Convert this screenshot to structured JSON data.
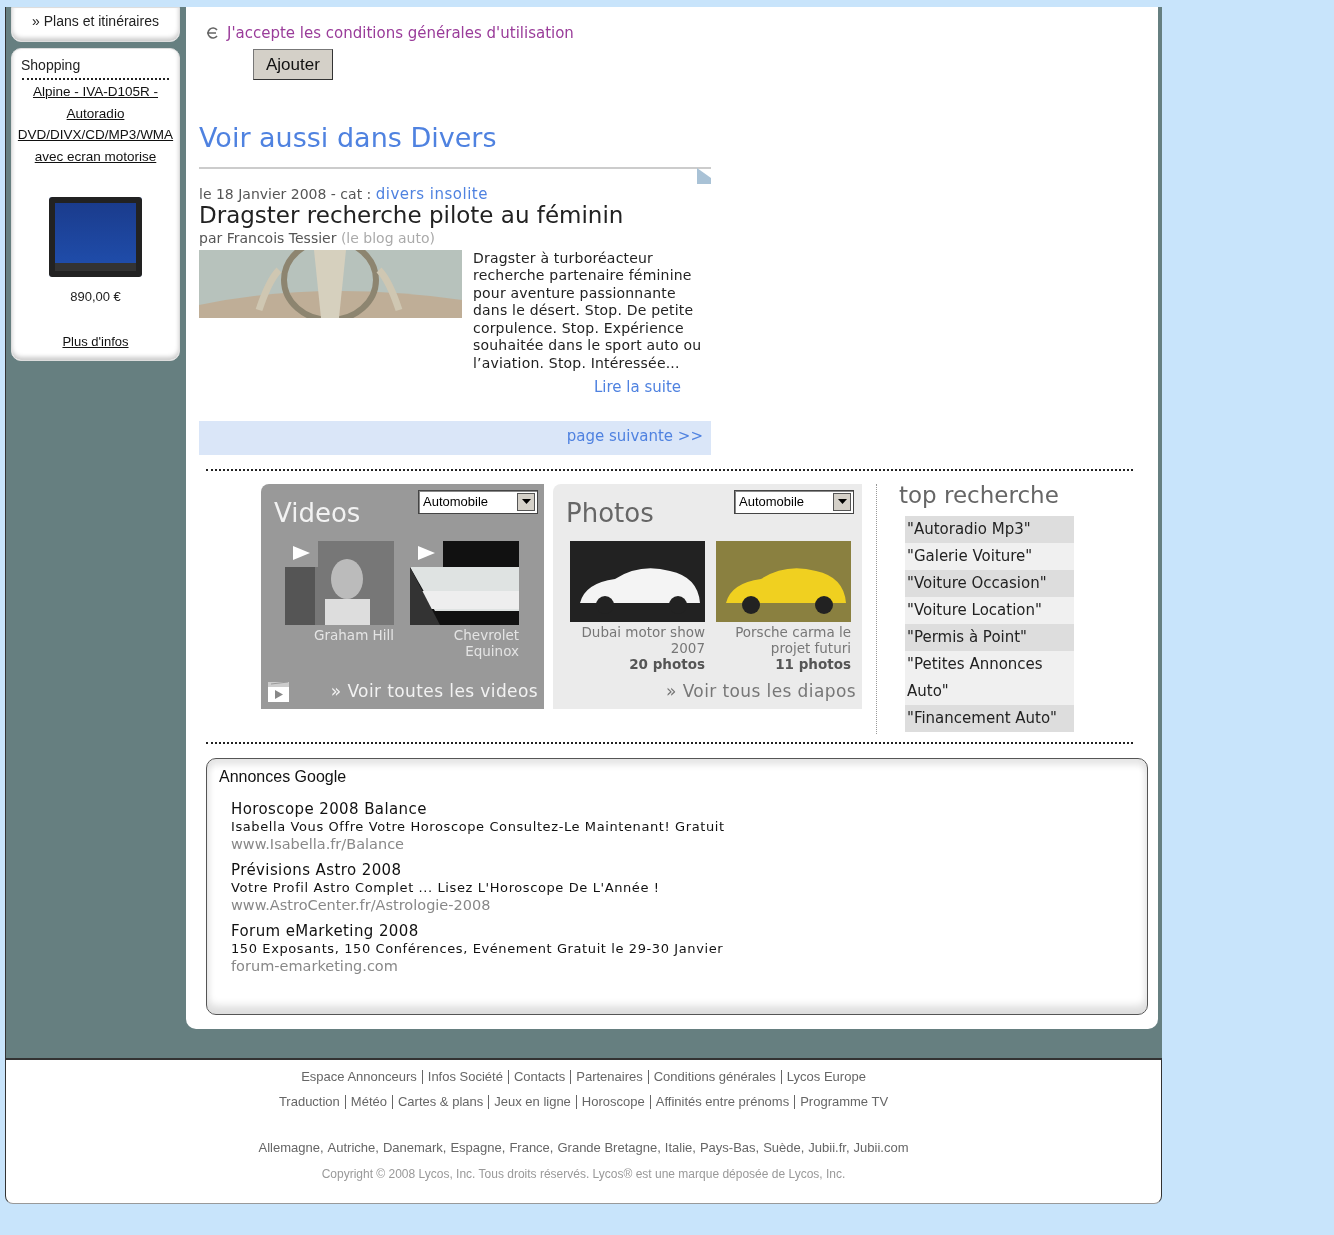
{
  "sidebar": {
    "nav_link": "» Plans et itinéraires",
    "shopping": {
      "title": "Shopping",
      "product_link": "Alpine - IVA-D105R - Autoradio DVD/DIVX/CD/MP3/WMA avec ecran motorise",
      "price": "890,00 €",
      "more_link": "Plus d'infos"
    }
  },
  "terms": {
    "prefix": "J'accepte les",
    "link": "conditions générales d'utilisation"
  },
  "submit_button": "Ajouter",
  "related": {
    "title": "Voir aussi dans Divers",
    "article": {
      "date": "le 18 Janvier 2008 - cat :",
      "category": "divers insolite",
      "title": "Dragster recherche pilote au féminin",
      "author": "par Francois Tessier",
      "source": "(le blog auto)",
      "summary": "Dragster à turboréacteur recherche partenaire féminine pour aventure passionnante dans le désert. Stop. De petite corpulence. Stop. Expérience souhaitée dans le sport auto ou l’aviation. Stop. Intéressée...",
      "read_more": "Lire la suite"
    },
    "next_page": "page suivante >>"
  },
  "videos": {
    "title": "Videos",
    "dropdown": "Automobile",
    "items": [
      {
        "caption": "Graham Hill"
      },
      {
        "caption": "Chevrolet Equinox"
      }
    ],
    "link": "» Voir toutes les videos"
  },
  "photos": {
    "title": "Photos",
    "dropdown": "Automobile",
    "items": [
      {
        "caption": "Dubai motor show 2007",
        "count": "20 photos",
        "kind": "white-car"
      },
      {
        "caption": "Porsche carma le projet futuri",
        "count": "11 photos",
        "kind": "yellow-car"
      }
    ],
    "link": "» Voir tous les diapos"
  },
  "top_search": {
    "title": "top recherche",
    "items": [
      "\"Autoradio Mp3\"",
      "\"Galerie Voiture\"",
      "\"Voiture Occasion\"",
      "\"Voiture Location\"",
      "\"Permis à Point\"",
      "\"Petites Annonces Auto\"",
      "\"Financement Auto\""
    ]
  },
  "ads": {
    "title": "Annonces Google",
    "items": [
      {
        "title": "Horoscope 2008 Balance",
        "text": "Isabella Vous Offre Votre Horoscope Consultez-Le Maintenant! Gratuit",
        "url": "www.Isabella.fr/Balance"
      },
      {
        "title": "Prévisions Astro 2008",
        "text": "Votre Profil Astro Complet ... Lisez L'Horoscope De L'Année !",
        "url": "www.AstroCenter.fr/Astrologie-2008"
      },
      {
        "title": "Forum eMarketing 2008",
        "text": "150 Exposants, 150 Conférences, Evénement Gratuit le 29-30 Janvier",
        "url": "forum-emarketing.com"
      }
    ]
  },
  "footer": {
    "links_1": [
      "Espace Annonceurs",
      "Infos Société",
      "Contacts",
      "Partenaires",
      "Conditions générales",
      "Lycos Europe"
    ],
    "links_2": [
      "Traduction",
      "Météo",
      "Cartes & plans",
      "Jeux en ligne",
      "Horoscope",
      "Affinités entre prénoms",
      "Programme TV"
    ],
    "countries": [
      "Allemagne,",
      "Autriche,",
      "Danemark,",
      "Espagne,",
      "France,",
      "Grande Bretagne,",
      "Italie,",
      "Pays-Bas,",
      "Suède,",
      "Jubii.fr,",
      "Jubii.com"
    ],
    "copyright": "Copyright © 2008 Lycos, Inc. Tous droits réservés. Lycos® est une marque déposée de Lycos, Inc."
  }
}
